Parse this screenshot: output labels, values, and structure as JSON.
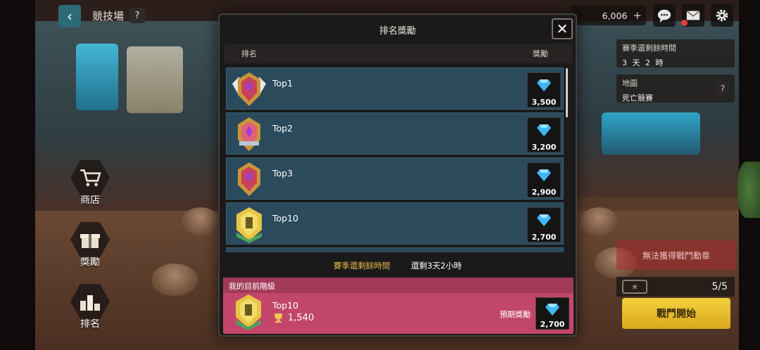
{
  "header": {
    "title": "競技場",
    "help": "?",
    "gems": "6,006",
    "gems_plus": "+"
  },
  "side_menu": [
    {
      "label": "商店"
    },
    {
      "label": "獎勵"
    },
    {
      "label": "排名"
    }
  ],
  "right_panel": {
    "season_title": "賽季還剩餘時間",
    "season_value": "3 天 2 時",
    "map_title": "地圖",
    "map_value": "死亡競賽",
    "map_help": "?",
    "medal_warning": "無法獲得戰鬥勳章",
    "tickets": "5/5",
    "battle_button": "戰鬥開始"
  },
  "modal": {
    "title": "排名獎勵",
    "close": "✕",
    "col_rank": "排名",
    "col_reward": "獎勵",
    "rows": [
      {
        "rank": "Top1",
        "reward": "3,500"
      },
      {
        "rank": "Top2",
        "reward": "3,200"
      },
      {
        "rank": "Top3",
        "reward": "2,900"
      },
      {
        "rank": "Top10",
        "reward": "2,700"
      }
    ],
    "season_label": "賽季還剩餘時間",
    "season_value": "還剩3天2小時",
    "mine": {
      "header": "我的目前階級",
      "rank": "Top10",
      "points": "1,540",
      "expected_label": "預期獎勵",
      "reward": "2,700"
    }
  },
  "colors": {
    "gem": "#3fb7f5",
    "row_bg": "#2b4a5c",
    "mine_bg": "#c2466a",
    "accent_gold": "#e3b64a"
  },
  "icons": [
    "back-arrow-icon",
    "help-icon",
    "gem-icon",
    "chat-icon",
    "mail-icon",
    "gear-icon",
    "close-icon",
    "cart-icon",
    "gift-icon",
    "podium-icon",
    "trophy-icon",
    "emblem-icon",
    "ticket-icon"
  ]
}
